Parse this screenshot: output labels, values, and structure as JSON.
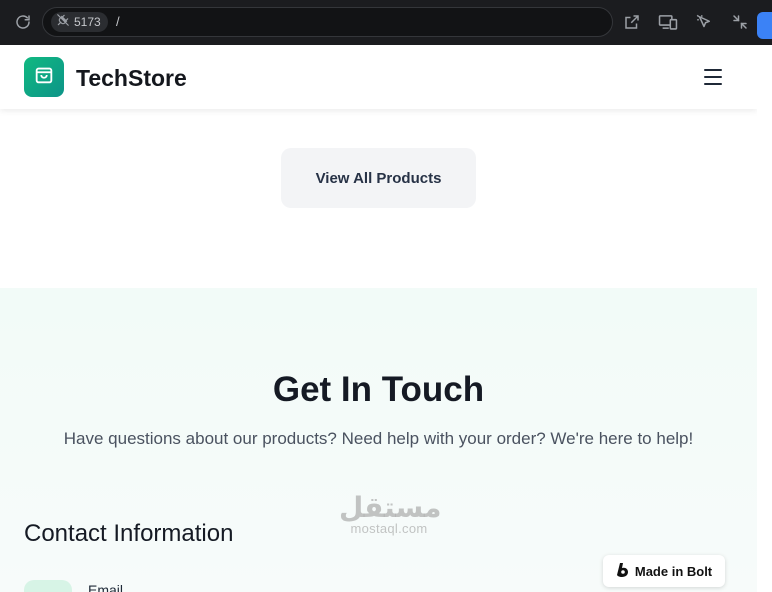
{
  "browser": {
    "port": "5173",
    "path": "/"
  },
  "navbar": {
    "brand": "TechStore"
  },
  "products": {
    "view_all_label": "View All Products"
  },
  "contact": {
    "title": "Get In Touch",
    "subtitle": "Have questions about our products? Need help with your order? We're here to help!",
    "info_title": "Contact Information",
    "email_label": "Email"
  },
  "watermark": {
    "arabic": "مستقل",
    "latin": "mostaql.com"
  },
  "badge": {
    "label": "Made in Bolt"
  },
  "colors": {
    "accent": "#10b981",
    "chrome_bg": "#1b1c1f",
    "section_bg": "#f2fbf8"
  },
  "icons": [
    "reload-icon",
    "plug-icon",
    "external-link-icon",
    "devices-icon",
    "pointer-icon",
    "minimize-icon",
    "shopping-bag-icon",
    "menu-icon",
    "bolt-icon"
  ]
}
